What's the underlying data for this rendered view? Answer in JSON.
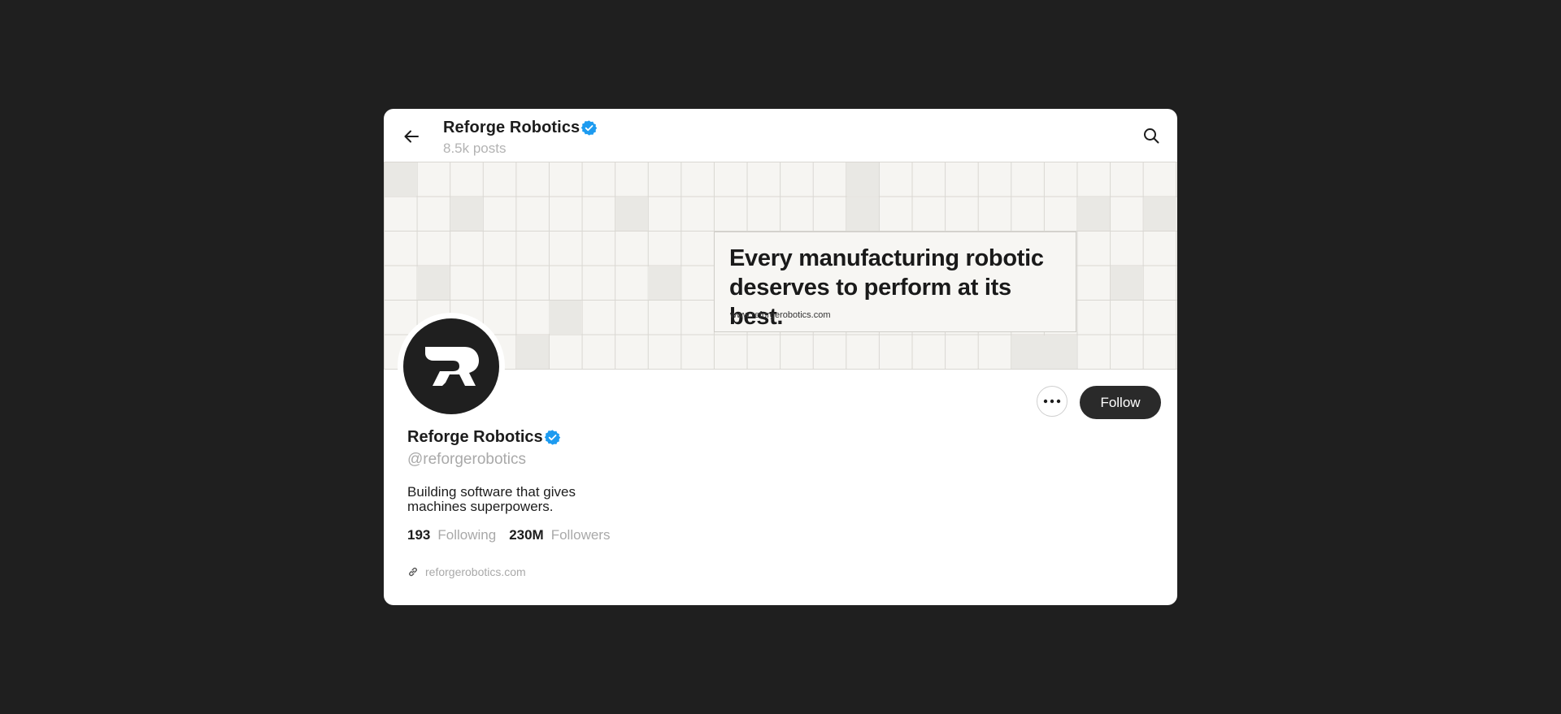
{
  "header": {
    "title": "Reforge Robotics",
    "post_count": "8.5k posts",
    "back_icon": "arrow-left-icon",
    "search_icon": "search-icon"
  },
  "banner": {
    "headline": "Every manufacturing robotic\ndeserves to perform at its best.",
    "url": "www.reforgerobotics.com"
  },
  "profile": {
    "display_name": "Reforge Robotics",
    "handle": "@reforgerobotics",
    "bio": "Building software that gives\nmachines superpowers.",
    "following_count": "193",
    "following_label": "Following",
    "followers_count": "230M",
    "followers_label": "Followers",
    "website": "reforgerobotics.com",
    "verified_color": "#1d9bf0"
  },
  "actions": {
    "more_icon": "more-horizontal-icon",
    "follow_label": "Follow"
  }
}
